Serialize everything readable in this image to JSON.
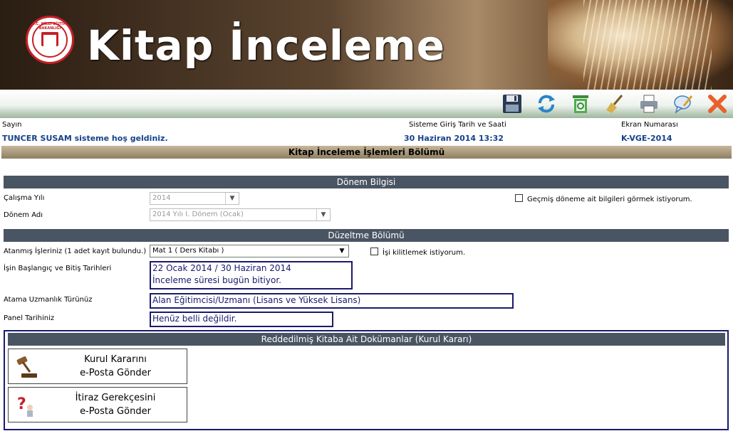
{
  "header": {
    "logo_text": "T.C. MİLLİ EĞİTİM BAKANLIĞI",
    "title": "Kitap İnceleme"
  },
  "toolbar": {
    "buttons": [
      {
        "name": "save",
        "icon": "floppy-disk-icon"
      },
      {
        "name": "refresh",
        "icon": "refresh-icon"
      },
      {
        "name": "recycle",
        "icon": "recycle-bin-icon"
      },
      {
        "name": "clear",
        "icon": "broom-icon"
      },
      {
        "name": "print",
        "icon": "printer-icon"
      },
      {
        "name": "comment",
        "icon": "speech-bubble-pen-icon"
      },
      {
        "name": "close",
        "icon": "close-x-icon"
      }
    ]
  },
  "info": {
    "greeting_label": "Sayın",
    "greeting_text": "TUNCER SUSAM sisteme hoş geldiniz.",
    "login_label": "Sisteme Giriş Tarih ve Saati",
    "login_value": "30 Haziran 2014 13:32",
    "screen_label": "Ekran Numarası",
    "screen_value": "K-VGE-2014"
  },
  "section_title": "Kitap İnceleme İşlemleri Bölümü",
  "donem": {
    "header": "Dönem Bilgisi",
    "year_label": "Çalışma Yılı",
    "year_value": "2014",
    "period_label": "Dönem Adı",
    "period_value": "2014 Yılı I. Dönem (Ocak)",
    "past_checkbox_label": "Geçmiş döneme ait bilgileri görmek istiyorum."
  },
  "duzeltme": {
    "header": "Düzeltme Bölümü",
    "tasks_label": "Atanmış İşleriniz (1 adet kayıt bulundu.)",
    "tasks_value": "Mat 1 ( Ders Kitabı )",
    "lock_checkbox_label": "İşi kilitlemek istiyorum.",
    "dates_label": "İşin Başlangıç ve Bitiş Tarihleri",
    "dates_line1": "22 Ocak 2014 / 30 Haziran 2014",
    "dates_line2": "İnceleme süresi bugün bitiyor.",
    "spec_label": "Atama Uzmanlık Türünüz",
    "spec_value": "Alan Eğitimcisi/Uzmanı (Lisans ve Yüksek Lisans)",
    "panel_label": "Panel Tarihiniz",
    "panel_value": "Henüz belli değildir."
  },
  "documents": {
    "header": "Reddedilmiş Kitaba Ait Dokümanlar (Kurul Kararı)",
    "btn1_line1": "Kurul Kararını",
    "btn1_line2": "e-Posta Gönder",
    "btn2_line1": "İtiraz Gerekçesini",
    "btn2_line2": "e-Posta Gönder"
  }
}
